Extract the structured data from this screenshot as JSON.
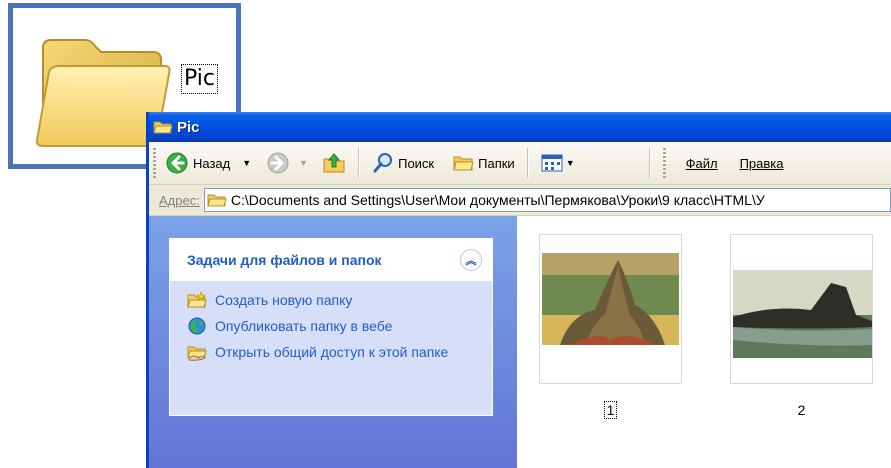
{
  "desktop_icon": {
    "label": "Pic",
    "icon": "folder-icon"
  },
  "window": {
    "title": "Pic",
    "icon": "folder-icon"
  },
  "toolbar": {
    "back_label": "Назад",
    "search_label": "Поиск",
    "folders_label": "Папки",
    "menu": [
      "Файл",
      "Правка"
    ]
  },
  "address": {
    "label": "Адрес:",
    "path": "C:\\Documents and Settings\\User\\Мои документы\\Пермякова\\Уроки\\9 класс\\HTML\\У"
  },
  "task_panel": {
    "title": "Задачи для файлов и папок",
    "items": [
      {
        "label": "Создать новую папку",
        "icon": "new-folder-icon"
      },
      {
        "label": "Опубликовать папку в вебе",
        "icon": "web-publish-icon"
      },
      {
        "label": "Открыть общий доступ к этой папке",
        "icon": "share-folder-icon"
      }
    ]
  },
  "files": [
    {
      "name": "1",
      "selected": true
    },
    {
      "name": "2",
      "selected": false
    }
  ],
  "colors": {
    "accent": "#0055e5",
    "task_text": "#215dc6",
    "callout_border": "#4a73b8"
  }
}
